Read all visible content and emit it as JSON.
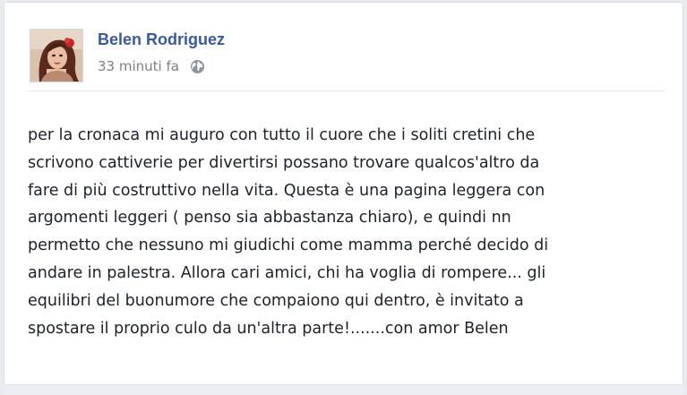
{
  "post": {
    "author": "Belen Rodriguez",
    "timestamp": "33 minuti fa",
    "privacy_icon": "globe-icon",
    "body": "per la cronaca mi auguro con tutto il cuore che i soliti cretini che\nscrivono cattiverie per divertirsi possano trovare qualcos'altro da\nfare di più costruttivo nella vita. Questa è una pagina leggera con\nargomenti leggeri ( penso sia abbastanza chiaro), e quindi nn\npermetto che nessuno mi giudichi come mamma perché decido di\nandare in palestra. Allora cari amici, chi ha voglia di rompere... gli\nequilibri del buonumore che compaiono qui dentro, è invitato a\nspostare il proprio culo da un'altra parte!.......con amor Belen"
  },
  "colors": {
    "author_link": "#3b5998",
    "meta_text": "#7f7f7f",
    "body_text": "#1d2129"
  }
}
